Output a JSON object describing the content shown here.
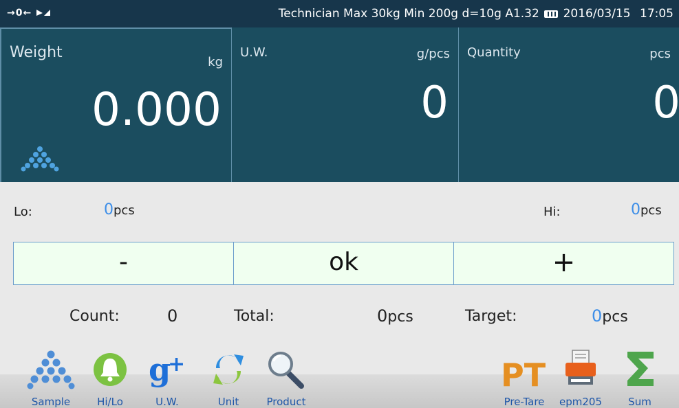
{
  "status_bar": {
    "zero_indicator": "→0←",
    "info": "Technician Max 30kg  Min 200g  d=10g A1.32",
    "date": "2016/03/15",
    "time": "17:05"
  },
  "panels": {
    "weight": {
      "label": "Weight",
      "unit": "kg",
      "value": "0.000"
    },
    "unit_weight": {
      "label": "U.W.",
      "unit": "g/pcs",
      "value": "0"
    },
    "quantity": {
      "label": "Quantity",
      "unit": "pcs",
      "value": "0"
    }
  },
  "limits": {
    "lo_label": "Lo:",
    "lo_value": "0",
    "lo_unit": "pcs",
    "hi_label": "Hi:",
    "hi_value": "0",
    "hi_unit": "pcs"
  },
  "buttons": {
    "minus": "-",
    "ok": "ok",
    "plus": "+"
  },
  "summary": {
    "count_label": "Count:",
    "count_value": "0",
    "total_label": "Total:",
    "total_value": "0",
    "total_unit": "pcs",
    "target_label": "Target:",
    "target_value": "0",
    "target_unit": "pcs"
  },
  "toolbar": [
    {
      "label": "Sample",
      "icon": "pyramid-icon"
    },
    {
      "label": "Hi/Lo",
      "icon": "bell-icon"
    },
    {
      "label": "U.W.",
      "icon": "g-plus-icon"
    },
    {
      "label": "Unit",
      "icon": "refresh-icon"
    },
    {
      "label": "Product",
      "icon": "magnifier-icon"
    },
    {
      "label": "Pre-Tare",
      "icon": "pt-icon"
    },
    {
      "label": "epm205",
      "icon": "printer-icon"
    },
    {
      "label": "Sum",
      "icon": "sigma-icon"
    }
  ],
  "colors": {
    "status_bg": "#17364b",
    "panel_bg": "#1b4d5f",
    "accent_blue": "#3d8ee8",
    "button_bg": "#f0fff0",
    "bell_green": "#7cc242",
    "pt_orange": "#e58f22",
    "sigma_green": "#4ea54c"
  }
}
